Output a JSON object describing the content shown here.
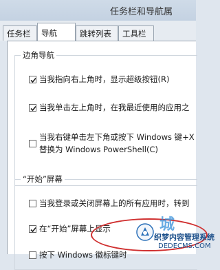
{
  "window": {
    "title": "任务栏和导航属"
  },
  "tabs": [
    {
      "label": "任务栏"
    },
    {
      "label": "导航"
    },
    {
      "label": "跳转列表"
    },
    {
      "label": "工具栏"
    }
  ],
  "corner_nav": {
    "heading": "边角导航",
    "items": [
      {
        "label": "当我指向右上角时，显示超级按钮(R)",
        "checked": true
      },
      {
        "label": "当我单击左上角时，在我最近使用的应用之",
        "checked": true
      },
      {
        "label": "当我右键单击左下角或按下 Windows 键+X",
        "label2": "替换为 Windows PowerShell(C)",
        "checked": false
      }
    ]
  },
  "start_screen": {
    "heading": "“开始”屏幕",
    "items": [
      {
        "label": "当我登录或关闭屏幕上的所有应用时，转到",
        "checked": false
      },
      {
        "label": "在“开始”屏幕上显示",
        "checked": true
      },
      {
        "label": "按下 Windows 徽标键时",
        "checked": false
      }
    ]
  },
  "watermark": {
    "text": "织梦内容管理系统",
    "url": "DEDECMS.COM",
    "overlay": "城"
  }
}
